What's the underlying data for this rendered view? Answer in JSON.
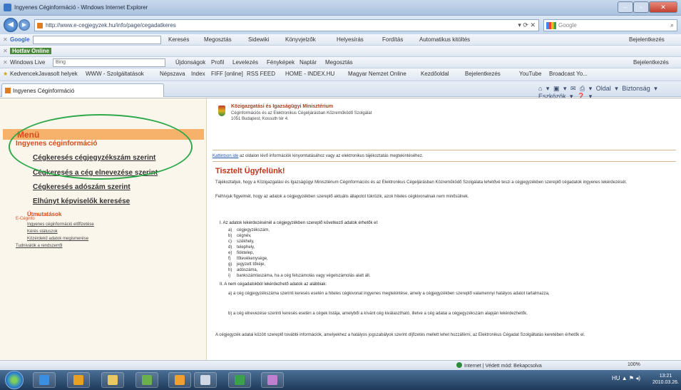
{
  "window": {
    "title": "Ingyenes Céginformáció - Windows Internet Explorer",
    "buttons": {
      "minimize": "–",
      "maximize": "▫",
      "close": "✕"
    }
  },
  "address_bar": {
    "url": "http://www.e-cegjegyzek.hu/info/page/cegadatkeres",
    "controls": "▾  ⟳  ✕",
    "search_placeholder": "Google",
    "search_icon": "⌕"
  },
  "google_toolbar": {
    "label": "Google",
    "items": [
      "Keresés",
      "Megosztás",
      "Sidewiki",
      "Könyvjelzők",
      "Helyesírás",
      "Fordítás",
      "Automatikus kitöltés"
    ],
    "right": "Bejelentkezés"
  },
  "hotfav_toolbar": {
    "label": "Hotfav Online"
  },
  "wlive_toolbar": {
    "label": "Windows Live",
    "search_value": "Bing",
    "items": [
      "Újdonságok",
      "Profil",
      "Levelezés",
      "Fényképek",
      "Naptár",
      "Megosztás"
    ],
    "right": "Bejelentkezés"
  },
  "favorites_bar": {
    "items": [
      "Kedvencek",
      "Javasolt helyek",
      "WWW - Szolgáltatások",
      "Népszava",
      "Index",
      "FIFF [online]",
      "RSS FEED",
      "HOME - INDEX.HU",
      "Magyar Nemzet Online",
      "Kezdőoldal",
      "Bejelentkezés",
      "YouTube",
      "Broadcast Yo..."
    ]
  },
  "tab": {
    "title": "Ingyenes Céginformáció",
    "tools": "⌂ ▾  ▣ ▾  ✉  ⎙ ▾  Oldal ▾  Biztonság ▾  Eszközök ▾  ❓ ▾"
  },
  "sidebar": {
    "menu_title": "Menü",
    "subtitle": "Ingyenes céginformáció",
    "links": [
      "Cégkeresés cégjegyzékszám szerint",
      "Cégkeresés a cég elnevezése szerint",
      "Cégkeresés adószám szerint",
      "Elhúnyt képviselők keresése"
    ],
    "sub_section": "Útmutatások",
    "small_links": [
      "E-Céginfo",
      "Ingyenes céginformáció előfizetése",
      "Kérés státuszok",
      "Közérdekű adatok megismerése",
      "Tudnivalók a rendszerről"
    ]
  },
  "main": {
    "org_name": "Közigazgatási és Igazságügyi Minisztérium",
    "org_sub1": "Céginformációs és az Elektronikus Cégeljárásban Közreműködő Szolgálat",
    "org_sub2": "1051 Budapest, Kossuth tér 4.",
    "notice_link": "Kattintson ide",
    "notice_text": " az oldalon lévő információk kinyomtatásához vagy az elektronikus tájékoztatás megtekintéséhez.",
    "greeting": "Tisztelt Ügyfelünk!",
    "para1": "Tájékoztatjuk, hogy a Közigazgatási és Igazságügyi Minisztérium Céginformációs és az Elektronikus Cégeljárásban Közreműködő Szolgálata lehetővé teszi a cégjegyzékben szereplő cégadatok ingyenes lekérdezését.",
    "para2": "Felhívjuk figyelmét, hogy az adatok a cégjegyzékben szereplő aktuális állapotot tükrözik, azok hiteles cégkivonatnak nem minősülnek.",
    "section1_title": "I.     Az adatok lekérdezésénél a cégjegyzékben szereplő következő adatok érhetők el:",
    "section1_items": [
      {
        "k": "a)",
        "v": "cégjegyzékszám,"
      },
      {
        "k": "b)",
        "v": "cégnév,"
      },
      {
        "k": "c)",
        "v": "székhely,"
      },
      {
        "k": "d)",
        "v": "telephely,"
      },
      {
        "k": "e)",
        "v": "fióktelep,"
      },
      {
        "k": "f)",
        "v": "főtevékenysége,"
      },
      {
        "k": "g)",
        "v": "jegyzett tőkéje,"
      },
      {
        "k": "h)",
        "v": "adószáma,"
      },
      {
        "k": "i)",
        "v": "bankszámlaszáma, ha a cég felszámolás vagy végelszámolás alatt áll."
      }
    ],
    "section2_title": "II.    A nem cégadatokból lekérdezhető adatok az alábbiak:",
    "section2_item_a": "a)    a cég cégjegyzékszáma szerinti keresés esetén a hiteles cégkivonat ingyenes megtekintése, amely a cégjegyzékben szereplő valamennyi hatályos adatot tartalmazza,",
    "section2_item_b": "b)    a cég elnevezése szerinti keresés esetén a cégek listája, amelyből a kívánt cég kiválasztható, illetve a cég adatai a cégjegyzékszám alapján lekérdezhetők.",
    "footer_para": "A cégjegyzék adatai között szereplő további információk, amelyekhez a hatályos jogszabályok szerint díjfizetés mellett lehet hozzáférni, az Elektronikus Cégadat Szolgáltatás keretében érhetők el."
  },
  "status_bar": {
    "zone": "Internet | Védett mód: Bekapcsolva",
    "zoom": "100%"
  },
  "taskbar": {
    "tray": "HU  ▲  ⚑  ◂)",
    "time": "13:21",
    "date": "2010.03.26."
  }
}
